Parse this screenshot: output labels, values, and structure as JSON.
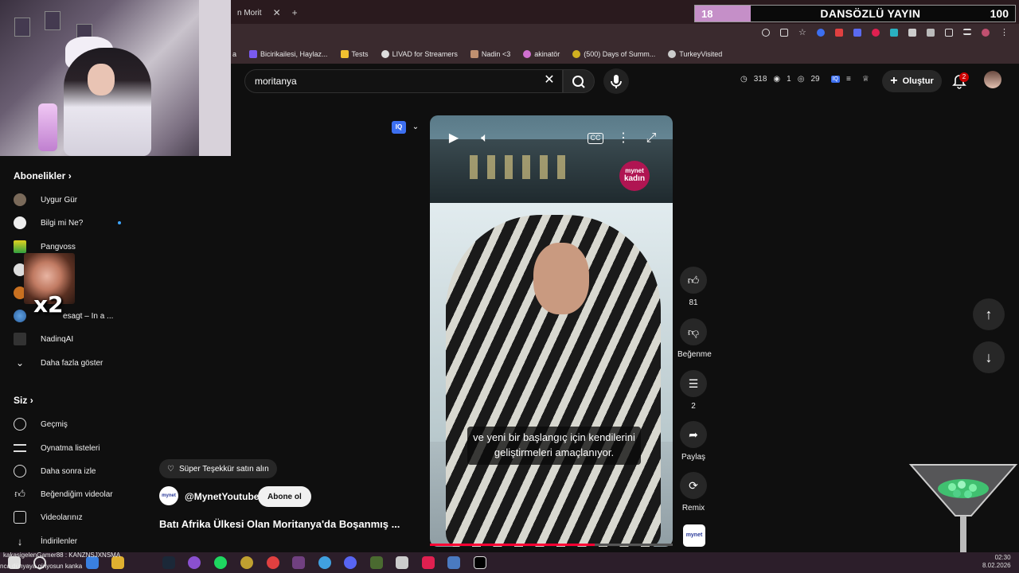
{
  "browser": {
    "tab_title": "n Morit",
    "bookmarks": [
      "a",
      "Bicirikailesi, Haylaz...",
      "Tests",
      "LIVAD for Streamers",
      "Nadin <3",
      "akinatör",
      "(500) Days of Summ...",
      "TurkeyVisited"
    ]
  },
  "overlay": {
    "banner_left": "18",
    "banner_title": "DANSÖZLÜ YAYIN",
    "banner_right": "100",
    "meme_text": "x2"
  },
  "header": {
    "search_value": "moritanya",
    "stats": [
      "318",
      "1",
      "29"
    ],
    "create_label": "Oluştur",
    "notification_count": "2"
  },
  "sidebar": {
    "subscriptions_title": "Abonelikler",
    "subscriptions": [
      {
        "label": "Uygur Gür"
      },
      {
        "label": "Bilgi mi Ne?"
      },
      {
        "label": "Pangvoss"
      },
      {
        "label": ""
      },
      {
        "label": ""
      },
      {
        "label": "esagt – In a ..."
      },
      {
        "label": "NadinqAI"
      }
    ],
    "show_more": "Daha fazla göster",
    "you_title": "Siz",
    "you_items": [
      {
        "label": "Geçmiş"
      },
      {
        "label": "Oynatma listeleri"
      },
      {
        "label": "Daha sonra izle"
      },
      {
        "label": "Beğendiğim videolar"
      },
      {
        "label": "Videolarınız"
      },
      {
        "label": "İndirilenler"
      }
    ]
  },
  "player": {
    "subtitle_line1": "ve yeni bir başlangıç için kendilerini",
    "subtitle_line2": "geliştirmeleri amaçlanıyor.",
    "logo_line1": "mynet",
    "logo_line2": "kadın",
    "progress": 0.68,
    "iq_label": "IQ"
  },
  "actions": {
    "like_count": "81",
    "dislike_label": "Beğenme",
    "comment_count": "2",
    "share_label": "Paylaş",
    "remix_label": "Remix",
    "channel_thumb": "mynet"
  },
  "channel": {
    "thanks_label": "Süper Teşekkür satın alın",
    "handle": "@MynetYoutube",
    "subscribe_label": "Abone ol",
    "avatar_text": "mynet",
    "video_title": "Batı Afrika Ülkesi Olan Moritanya'da Boşanmış ..."
  },
  "chat": {
    "line1": "kakasigelenGamer88 : KANZNSJXNSMA",
    "line2": "nca dünyaya giriyosun kanka"
  },
  "taskbar": {
    "time": "02:30",
    "date": "8.02.2026"
  },
  "colors": {
    "accent_red": "#ff0033",
    "banner_pink": "#c58fc8",
    "mynet_pink": "#b01552"
  }
}
